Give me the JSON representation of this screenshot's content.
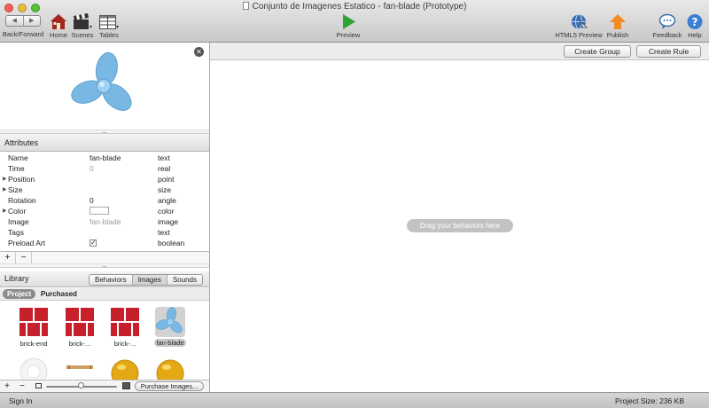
{
  "window": {
    "title": "Conjunto de Imagenes Estatico - fan-blade (Prototype)"
  },
  "toolbar": {
    "back_forward": "Back/Forward",
    "home": "Home",
    "scenes": "Scenes",
    "tables": "Tables",
    "preview": "Preview",
    "html5_preview": "HTML5 Preview",
    "publish": "Publish",
    "feedback": "Feedback",
    "help": "Help"
  },
  "colors": {
    "fan_blue": "#7ab8e4",
    "brick_red": "#c8202a",
    "play_green": "#2ea336",
    "publish_orange": "#ef8a24"
  },
  "attributes": {
    "header": "Attributes",
    "rows": [
      {
        "name": "Name",
        "value": "fan-blade",
        "type": "text"
      },
      {
        "name": "Time",
        "value": "0",
        "type": "real"
      },
      {
        "name": "Position",
        "value": "",
        "type": "point"
      },
      {
        "name": "Size",
        "value": "",
        "type": "size"
      },
      {
        "name": "Rotation",
        "value": "0",
        "type": "angle"
      },
      {
        "name": "Color",
        "value": "",
        "type": "color"
      },
      {
        "name": "Image",
        "value": "fan-blade",
        "type": "image"
      },
      {
        "name": "Tags",
        "value": "",
        "type": "text"
      },
      {
        "name": "Preload Art",
        "value": "",
        "type": "boolean"
      }
    ],
    "preload_art_checked": true
  },
  "library": {
    "title": "Library",
    "tabs": [
      "Behaviors",
      "Images",
      "Sounds"
    ],
    "selected_tab": "Images",
    "subtabs": {
      "project": "Project",
      "purchased": "Purchased"
    },
    "assets": [
      {
        "label": "brick-end",
        "icon": "brick-icon"
      },
      {
        "label": "brick-...",
        "icon": "brick-icon"
      },
      {
        "label": "brick-...",
        "icon": "brick-icon"
      },
      {
        "label": "fan-blade",
        "icon": "fan-blade-icon"
      }
    ],
    "purchase_button": "Purchase Images..."
  },
  "rules": {
    "create_group": "Create Group",
    "create_rule": "Create Rule",
    "drop_hint": "Drag your behaviors here"
  },
  "status": {
    "sign_in": "Sign In",
    "project_size": "Project Size: 236 KB"
  }
}
